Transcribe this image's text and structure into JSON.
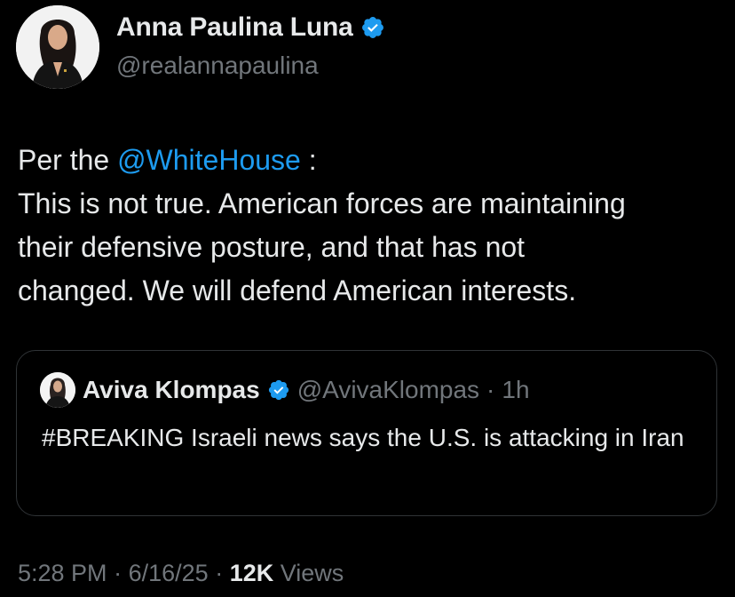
{
  "author": {
    "name": "Anna Paulina Luna",
    "handle": "@realannapaulina",
    "verified_icon": "verified-badge-icon"
  },
  "tweet": {
    "line1_prefix": "Per the ",
    "line1_mention": "@WhiteHouse",
    "line1_suffix": " :",
    "body": "This is not true. American forces are maintaining\ntheir defensive posture, and that has not\nchanged. We will defend American interests."
  },
  "quote": {
    "name": "Aviva Klompas",
    "handle": "@AvivaKlompas",
    "separator": "·",
    "time": "1h",
    "text": "#BREAKING Israeli news says the U.S. is attacking in Iran"
  },
  "meta": {
    "time": "5:28 PM",
    "separator": "·",
    "date": "6/16/25",
    "views_count": "12K",
    "views_label": "Views"
  },
  "colors": {
    "background": "#000000",
    "text": "#e7e9ea",
    "secondary": "#71767b",
    "accent": "#1d9bf0",
    "border": "#2f3336"
  }
}
